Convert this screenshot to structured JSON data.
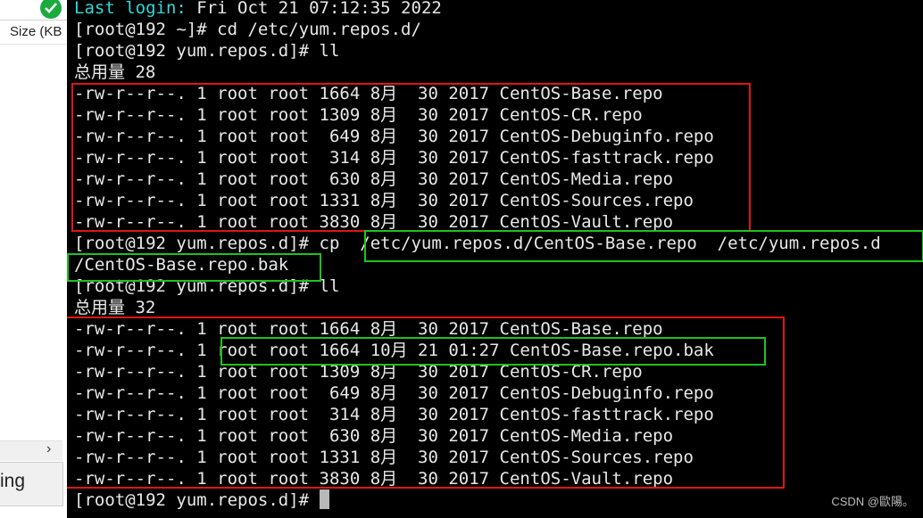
{
  "sidebar": {
    "size_header": "Size (KB",
    "chevron": "›",
    "truncated_label": "ing"
  },
  "terminal": {
    "login": {
      "label": "Last login:",
      "rest": " Fri Oct 21 07:12:35 2022"
    },
    "lines": [
      "[root@192 ~]# cd /etc/yum.repos.d/",
      "[root@192 yum.repos.d]# ll",
      "总用量 28",
      "-rw-r--r--. 1 root root 1664 8月  30 2017 CentOS-Base.repo",
      "-rw-r--r--. 1 root root 1309 8月  30 2017 CentOS-CR.repo",
      "-rw-r--r--. 1 root root  649 8月  30 2017 CentOS-Debuginfo.repo",
      "-rw-r--r--. 1 root root  314 8月  30 2017 CentOS-fasttrack.repo",
      "-rw-r--r--. 1 root root  630 8月  30 2017 CentOS-Media.repo",
      "-rw-r--r--. 1 root root 1331 8月  30 2017 CentOS-Sources.repo",
      "-rw-r--r--. 1 root root 3830 8月  30 2017 CentOS-Vault.repo",
      "[root@192 yum.repos.d]# cp  /etc/yum.repos.d/CentOS-Base.repo  /etc/yum.repos.d",
      "/CentOS-Base.repo.bak",
      "[root@192 yum.repos.d]# ll",
      "总用量 32",
      "-rw-r--r--. 1 root root 1664 8月  30 2017 CentOS-Base.repo",
      "-rw-r--r--. 1 root root 1664 10月 21 01:27 CentOS-Base.repo.bak",
      "-rw-r--r--. 1 root root 1309 8月  30 2017 CentOS-CR.repo",
      "-rw-r--r--. 1 root root  649 8月  30 2017 CentOS-Debuginfo.repo",
      "-rw-r--r--. 1 root root  314 8月  30 2017 CentOS-fasttrack.repo",
      "-rw-r--r--. 1 root root  630 8月  30 2017 CentOS-Media.repo",
      "-rw-r--r--. 1 root root 1331 8月  30 2017 CentOS-Sources.repo",
      "-rw-r--r--. 1 root root 3830 8月  30 2017 CentOS-Vault.repo"
    ],
    "prompt": "[root@192 yum.repos.d]# "
  },
  "watermark": "CSDN @歐陽。",
  "colors": {
    "background": "#000000",
    "text": "#e8e8e8",
    "login_label": "#30d8d8",
    "annotation_red": "#e01515",
    "annotation_green": "#1fc21f"
  }
}
